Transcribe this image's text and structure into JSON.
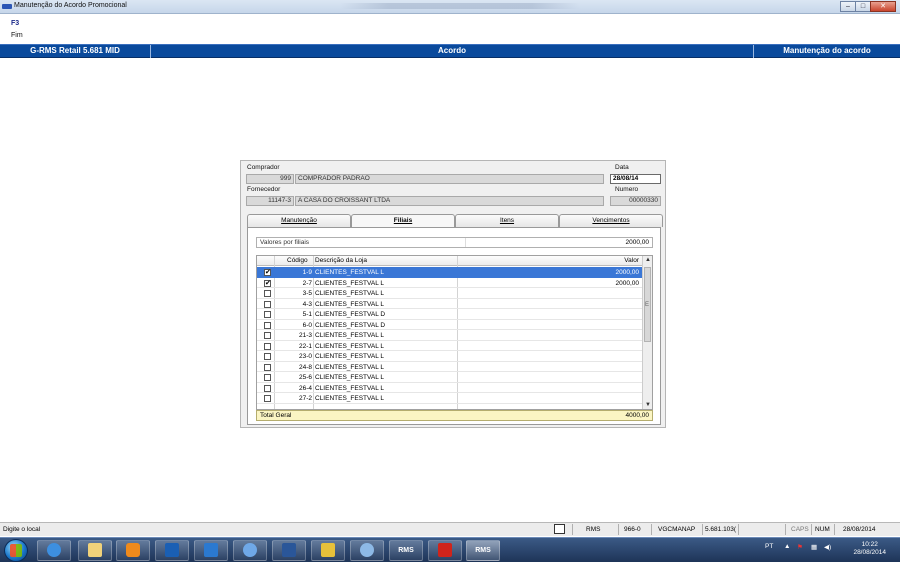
{
  "window": {
    "title": "Manutenção do Acordo Promocional",
    "buttons": [
      "–",
      "□",
      "✕"
    ]
  },
  "menu": {
    "key": "F3",
    "item": "Fim"
  },
  "header": {
    "left": "G-RMS Retail 5.681 MID",
    "center": "Acordo",
    "right": "Manutenção do acordo"
  },
  "form": {
    "comprador_label": "Comprador",
    "comprador_code": "999",
    "comprador_name": "COMPRADOR PADRAO",
    "data_label": "Data",
    "data_value": "28/08/14",
    "fornecedor_label": "Fornecedor",
    "fornecedor_code": "11147-3",
    "fornecedor_name": "A CASA DO CROISSANT LTDA",
    "numero_label": "Numero",
    "numero_value": "00000330"
  },
  "tabs": [
    "Manutenção",
    "Filiais",
    "Itens",
    "Vencimentos"
  ],
  "active_tab": "Filiais",
  "valores": {
    "label": "Valores por filiais",
    "value": "2000,00"
  },
  "grid": {
    "columns": {
      "codigo": "Código",
      "descricao": "Descrição da Loja",
      "valor": "Valor"
    },
    "rows": [
      {
        "checked": "✔",
        "codigo": "1-9",
        "descricao": "CLIENTES_FESTVAL L",
        "valor": "2000,00",
        "selected": true
      },
      {
        "checked": "✔",
        "codigo": "2-7",
        "descricao": "CLIENTES_FESTVAL L",
        "valor": "2000,00"
      },
      {
        "checked": "",
        "codigo": "3-5",
        "descricao": "CLIENTES_FESTVAL L",
        "valor": ""
      },
      {
        "checked": "",
        "codigo": "4-3",
        "descricao": "CLIENTES_FESTVAL L",
        "valor": ""
      },
      {
        "checked": "",
        "codigo": "5-1",
        "descricao": "CLIENTES_FESTVAL D",
        "valor": ""
      },
      {
        "checked": "",
        "codigo": "6-0",
        "descricao": "CLIENTES_FESTVAL D",
        "valor": ""
      },
      {
        "checked": "",
        "codigo": "21-3",
        "descricao": "CLIENTES_FESTVAL L",
        "valor": ""
      },
      {
        "checked": "",
        "codigo": "22-1",
        "descricao": "CLIENTES_FESTVAL L",
        "valor": ""
      },
      {
        "checked": "",
        "codigo": "23-0",
        "descricao": "CLIENTES_FESTVAL L",
        "valor": ""
      },
      {
        "checked": "",
        "codigo": "24-8",
        "descricao": "CLIENTES_FESTVAL L",
        "valor": ""
      },
      {
        "checked": "",
        "codigo": "25-6",
        "descricao": "CLIENTES_FESTVAL L",
        "valor": ""
      },
      {
        "checked": "",
        "codigo": "26-4",
        "descricao": "CLIENTES_FESTVAL L",
        "valor": ""
      },
      {
        "checked": "",
        "codigo": "27-2",
        "descricao": "CLIENTES_FESTVAL L",
        "valor": ""
      }
    ],
    "scroll_marker": "E"
  },
  "total": {
    "label": "Total Geral",
    "value": "4000,00"
  },
  "statusbar": {
    "hint": "Digite o local",
    "rms": "RMS",
    "code": "966-0",
    "user": "VGCMANAP",
    "version": "5.681.103(",
    "caps": "CAPS",
    "num": "NUM",
    "date": "28/08/2014"
  },
  "taskbar": {
    "apps": [
      "ie-icon",
      "folder-icon",
      "media-icon",
      "outlook-icon",
      "lync-icon",
      "infinity-icon",
      "word-icon",
      "install-icon",
      "rms-globe-icon",
      "rms-app-1",
      "pdf-icon",
      "rms-app-2"
    ],
    "rms_label": "RMS",
    "lang": "PT",
    "time": "10:22",
    "date": "28/08/2014"
  },
  "colors": {
    "header_blue": "#0a4a9c",
    "selection": "#3a77d6",
    "total_bg": "#fbf5c3"
  }
}
